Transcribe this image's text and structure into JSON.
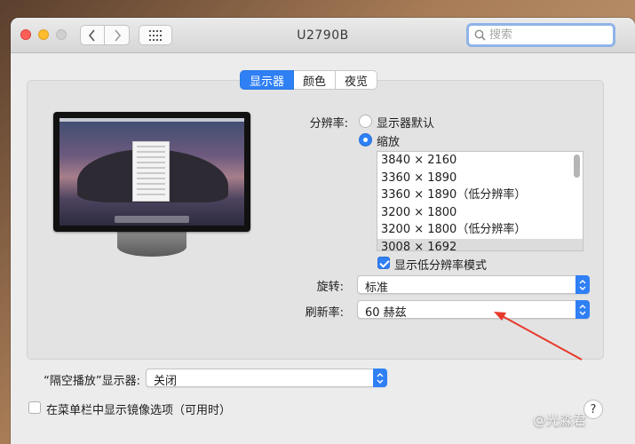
{
  "window": {
    "title": "U2790B"
  },
  "toolbar": {
    "back_icon": "chevron-left-icon",
    "forward_icon": "chevron-right-icon",
    "grid_icon": "grid-icon"
  },
  "search": {
    "placeholder": "搜索",
    "value": ""
  },
  "tabs": [
    {
      "label": "显示器",
      "active": true
    },
    {
      "label": "颜色",
      "active": false
    },
    {
      "label": "夜览",
      "active": false
    }
  ],
  "display": {
    "resolution_label": "分辨率:",
    "option_default": "显示器默认",
    "option_scaled": "缩放",
    "selected_option": "缩放",
    "resolutions": [
      "3840 × 2160",
      "3360 × 1890",
      "3360 × 1890（低分辨率）",
      "3200 × 1800",
      "3200 × 1800（低分辨率）",
      "3008 × 1692"
    ],
    "low_res_checkbox": {
      "label": "显示低分辨率模式",
      "checked": true
    },
    "rotation_label": "旋转:",
    "rotation_value": "标准",
    "refresh_label": "刷新率:",
    "refresh_value": "60 赫兹"
  },
  "airplay": {
    "label": "“隔空播放”显示器:",
    "value": "关闭"
  },
  "mirror_checkbox": {
    "label": "在菜单栏中显示镜像选项（可用时）",
    "checked": false
  },
  "help": {
    "label": "?"
  },
  "watermark": "@光淼君",
  "colors": {
    "accent": "#2f7ff5",
    "annotation_arrow": "#e8392b"
  }
}
